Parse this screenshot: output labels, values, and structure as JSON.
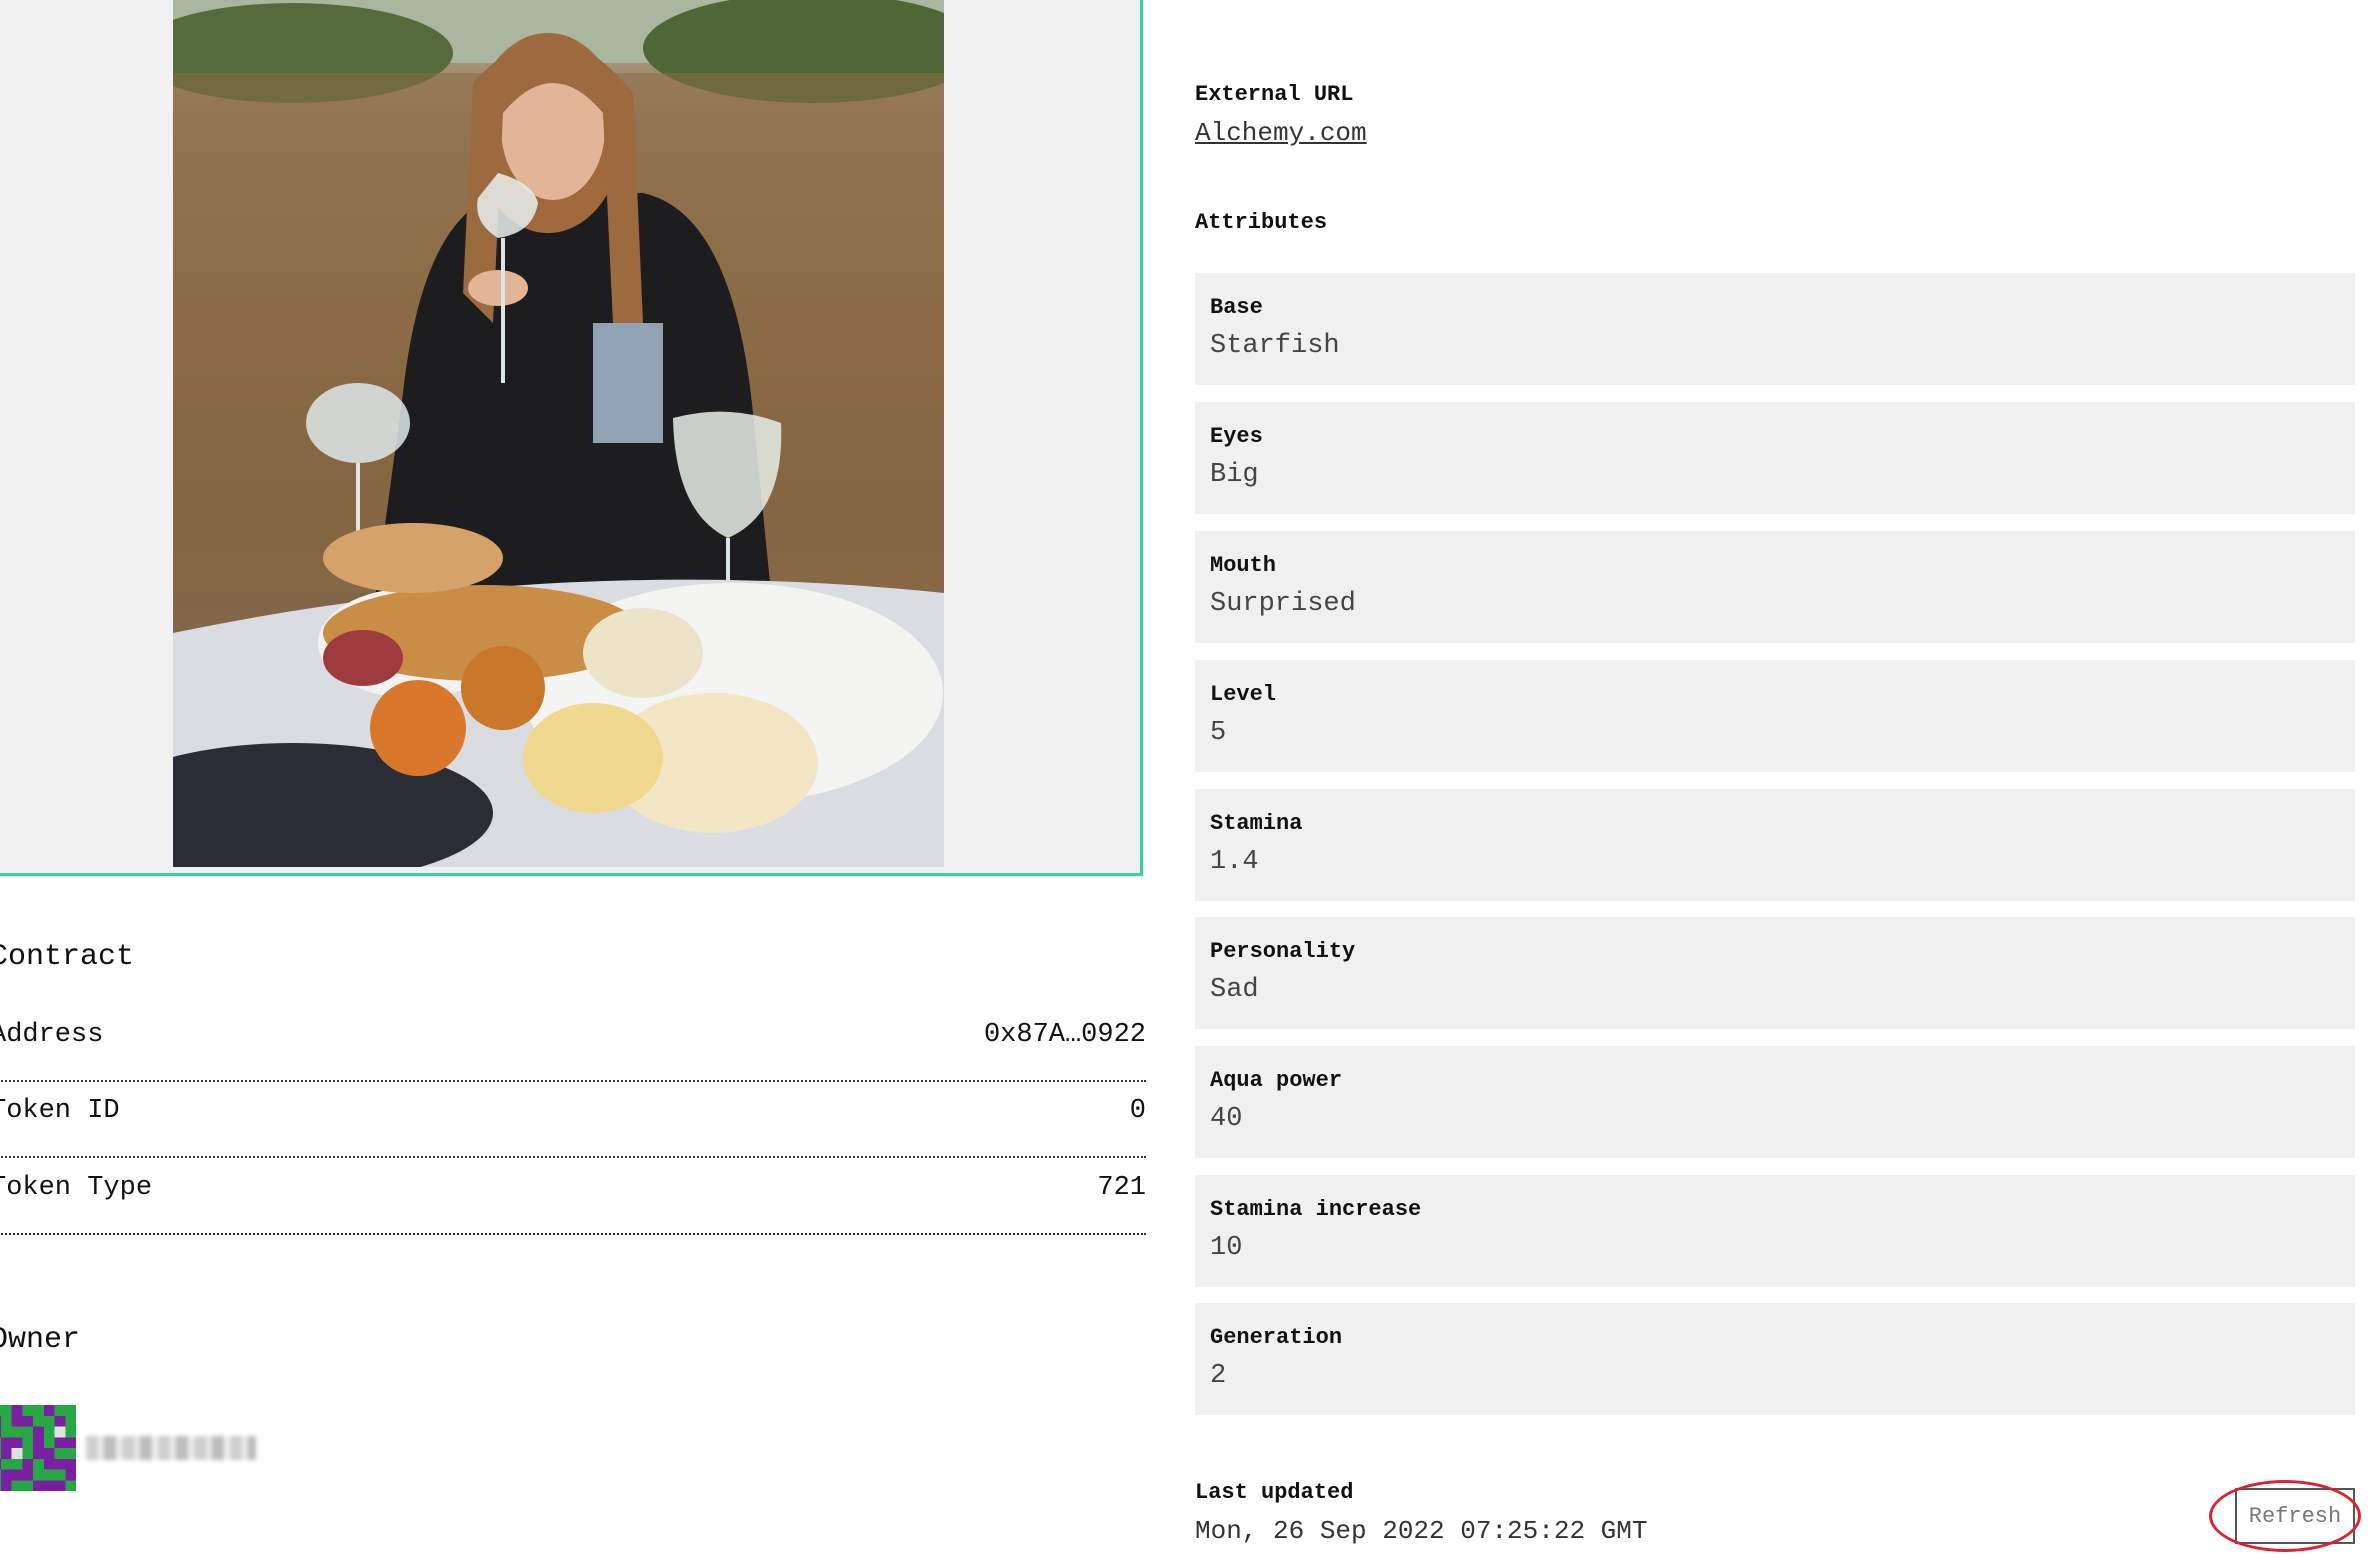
{
  "contract": {
    "title": "Contract",
    "rows": [
      {
        "label": "Address",
        "value": "0x87A…0922"
      },
      {
        "label": "Token ID",
        "value": "0"
      },
      {
        "label": "Token Type",
        "value": "721"
      }
    ]
  },
  "owner": {
    "title": "Owner"
  },
  "external_url": {
    "label": "External URL",
    "link_text": "Alchemy.com"
  },
  "attributes": {
    "title": "Attributes",
    "items": [
      {
        "type": "Base",
        "value": "Starfish"
      },
      {
        "type": "Eyes",
        "value": "Big"
      },
      {
        "type": "Mouth",
        "value": "Surprised"
      },
      {
        "type": "Level",
        "value": "5"
      },
      {
        "type": "Stamina",
        "value": "1.4"
      },
      {
        "type": "Personality",
        "value": "Sad"
      },
      {
        "type": "Aqua power",
        "value": "40"
      },
      {
        "type": "Stamina increase",
        "value": "10"
      },
      {
        "type": "Generation",
        "value": "2"
      }
    ]
  },
  "last_updated": {
    "label": "Last updated",
    "value": "Mon, 26 Sep 2022 07:25:22 GMT"
  },
  "refresh": {
    "label": "Refresh"
  },
  "colors": {
    "frame_border": "#2fd3a5",
    "highlight": "#e0202a",
    "card_bg": "#f0f0f0"
  }
}
